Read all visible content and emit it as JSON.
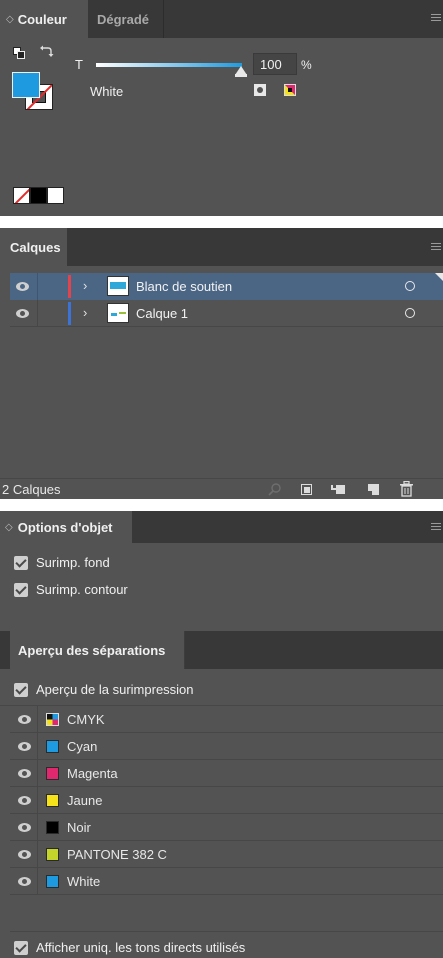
{
  "couleur_panel": {
    "tab_active": "Couleur",
    "tab_inactive": "Dégradé",
    "tint_letter": "T",
    "tint_value": "100",
    "percent_sign": "%",
    "swatch_name": "White",
    "tint_level_percent": 100,
    "fill_color": "#1e9be0"
  },
  "calques_panel": {
    "tab": "Calques",
    "layers": [
      {
        "name": "Blanc de soutien",
        "color": "#e3434b",
        "selected": true
      },
      {
        "name": "Calque 1",
        "color": "#3b73d6",
        "selected": false
      }
    ],
    "status": "2 Calques"
  },
  "options_panel": {
    "tab": "Options d'objet",
    "checkbox_fill": "Surimp. fond",
    "checkbox_stroke": "Surimp. contour"
  },
  "separations_panel": {
    "tab": "Aperçu des séparations",
    "preview_checkbox": "Aperçu de la surimpression",
    "inks": [
      {
        "name": "CMYK",
        "color": "cmyk"
      },
      {
        "name": "Cyan",
        "color": "#1e9be0"
      },
      {
        "name": "Magenta",
        "color": "#e0286f"
      },
      {
        "name": "Jaune",
        "color": "#f5e21b"
      },
      {
        "name": "Noir",
        "color": "#000000"
      },
      {
        "name": "PANTONE 382 C",
        "color": "#c4d42a"
      },
      {
        "name": "White",
        "color": "#1e9be0"
      }
    ],
    "bottom_checkbox": "Afficher uniq. les tons directs utilisés"
  }
}
